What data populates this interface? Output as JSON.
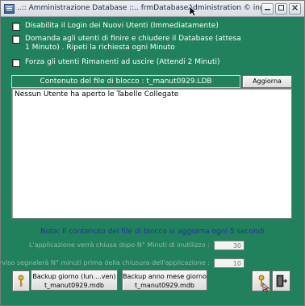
{
  "window": {
    "title": "..:: Amministrazione Database ::..  frmDatabaseAdministration © ing. Carlo Sca...",
    "controls": [
      "minimize",
      "maximize",
      "close"
    ]
  },
  "options": [
    {
      "label": "Disabilita il Login dei Nuovi Utenti (Immediatamente)",
      "checked": false
    },
    {
      "label": "Domanda agli utenti di finire e chiudere il Database (attesa 1 Minuto) . Ripeti la richiesta ogni Minuto",
      "checked": false
    },
    {
      "label": "Forza gli utenti Rimanenti ad uscire  (Attendi 2 Minuti)",
      "checked": false
    }
  ],
  "lock_file": {
    "header": "Contenuto del file di blocco :    t_manut0929.LDB",
    "refresh_label": "Aggiorna",
    "content": "Nessun Utente ha aperto le Tabelle Collegate"
  },
  "note": "Nota: Il contenuto del file di blocco si aggiorna ogni 5 secondi",
  "fields": [
    {
      "label": "L'applicazione verrà chiusa dopo N° Minuti di inutilizzo :",
      "value": "30"
    },
    {
      "label": "Un avviso segnalerà N° minuti prima della chiusura dell'applicazione :",
      "value": "10"
    }
  ],
  "buttons": {
    "backup_day": "Backup giorno (lun....ven)\nt_manut0929.mdb",
    "backup_date": "Backup anno mese giorno\nt_manut0929.mdb"
  },
  "icons": {
    "key": "key-icon",
    "exit": "exit-door-icon"
  },
  "colors": {
    "background": "#20815c",
    "note_text": "#25309f",
    "option_text": "#ffffff"
  }
}
